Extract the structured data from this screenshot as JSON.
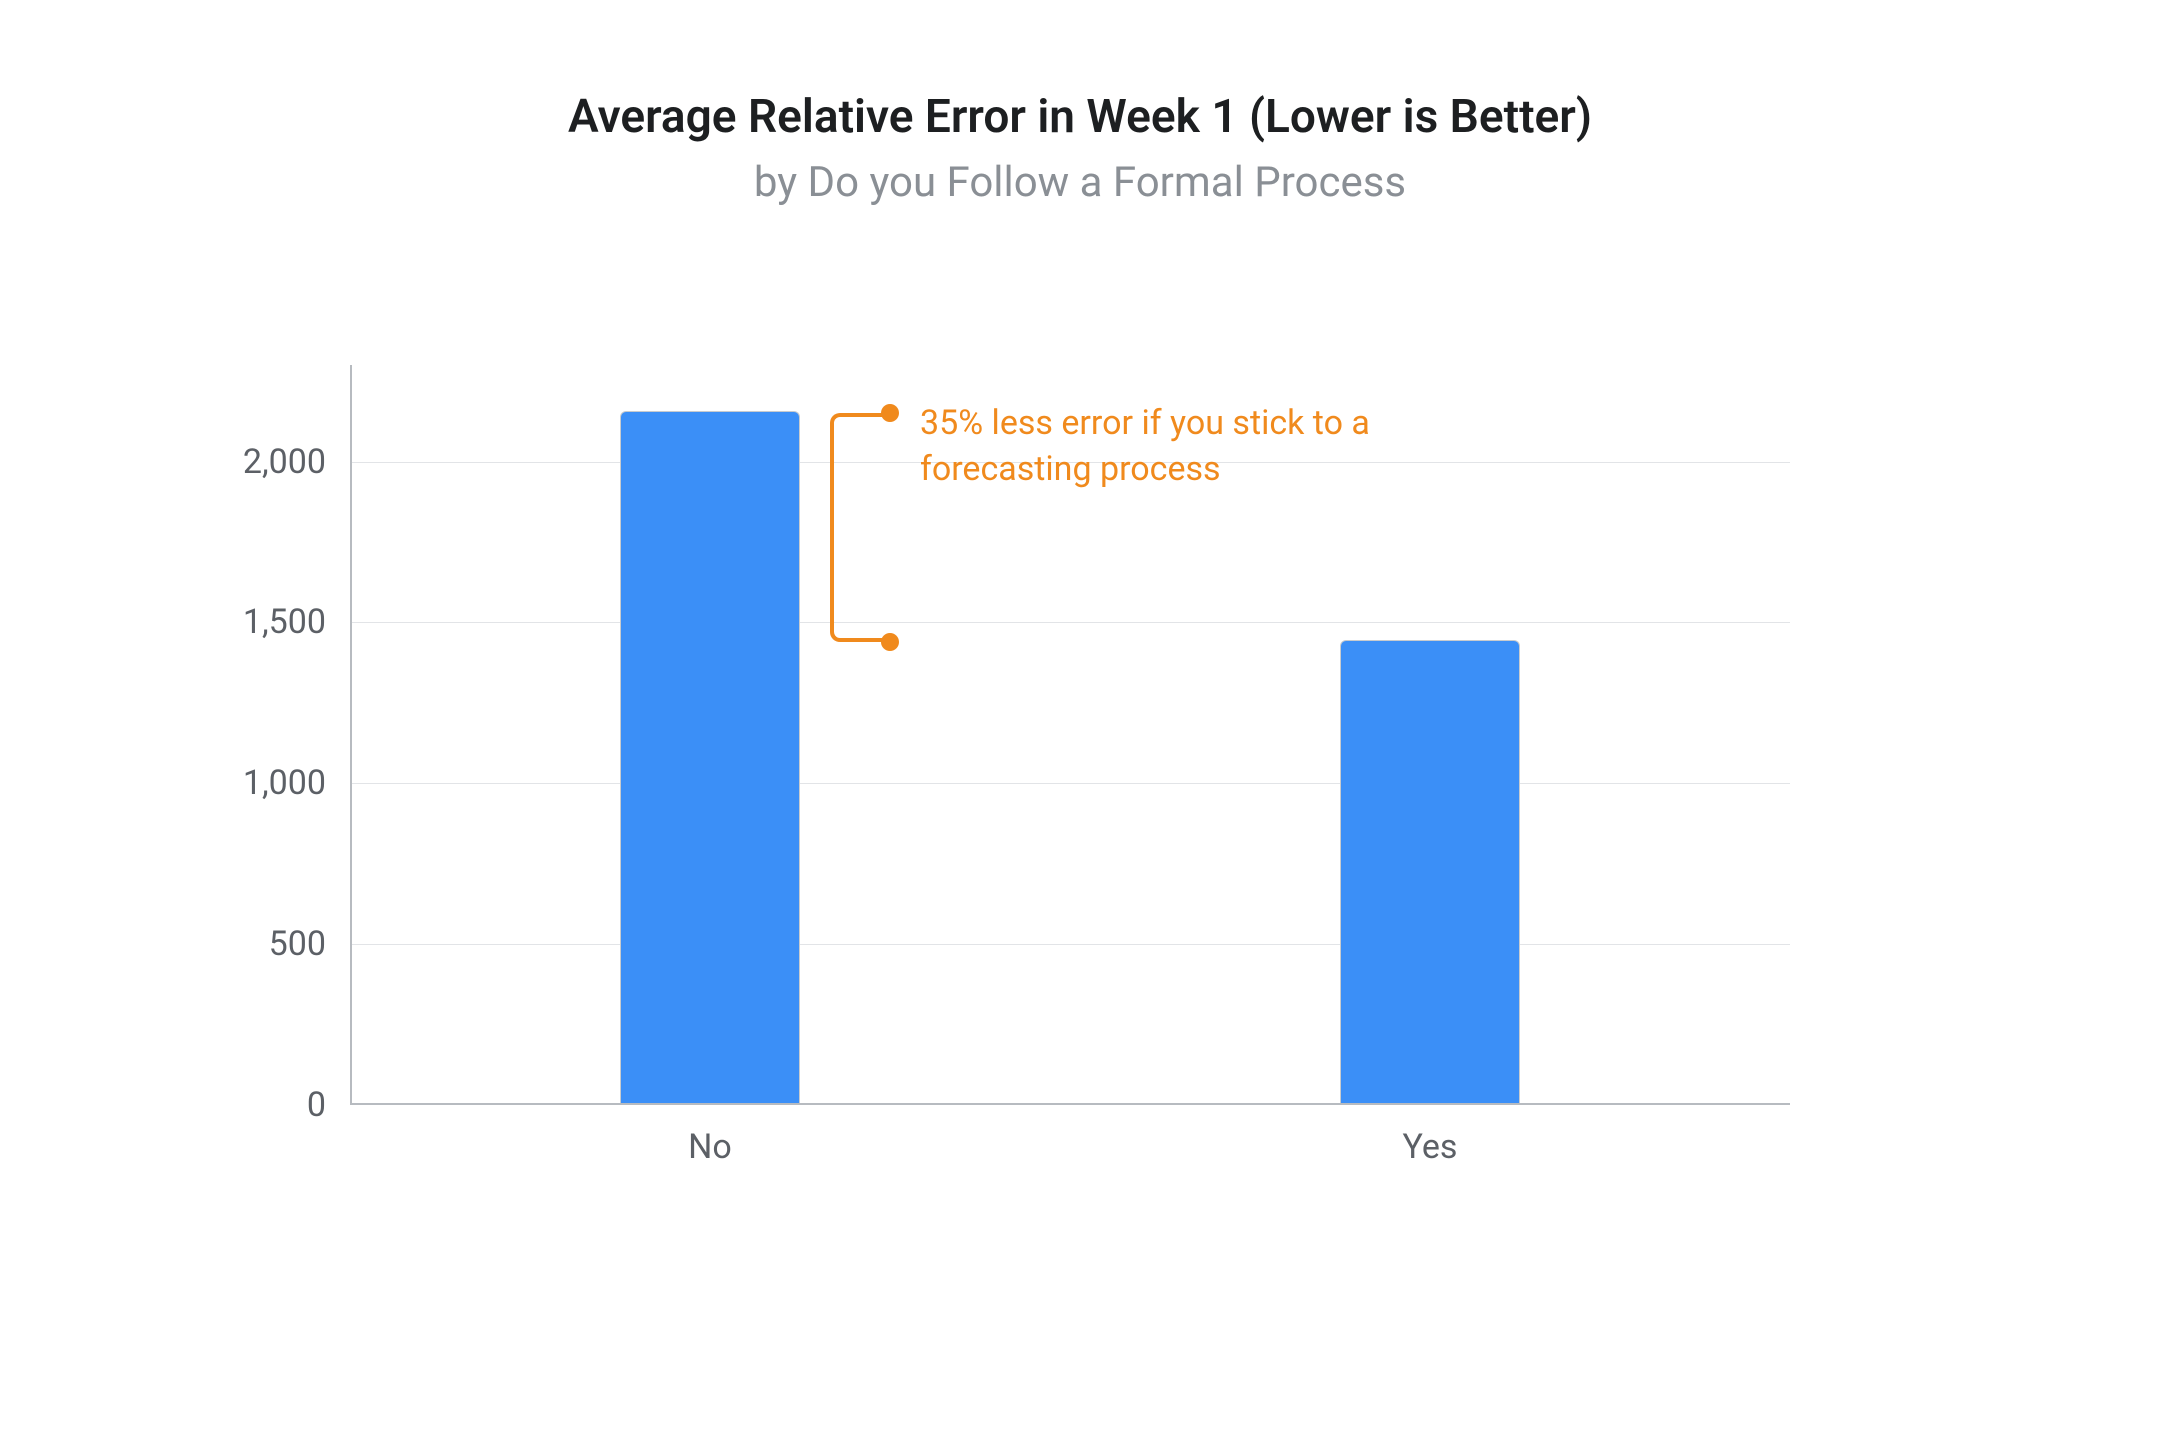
{
  "chart_data": {
    "type": "bar",
    "title": "Average Relative Error in Week 1 (Lower is Better)",
    "subtitle": "by Do you Follow a Formal Process",
    "categories": [
      "No",
      "Yes"
    ],
    "values": [
      2150,
      1440
    ],
    "ylim": [
      0,
      2300
    ],
    "yticks": [
      0,
      500,
      1000,
      1500,
      2000
    ],
    "ytick_labels": [
      "0",
      "500",
      "1,000",
      "1,500",
      "2,000"
    ],
    "xlabel": "",
    "ylabel": "",
    "annotation": {
      "text": "35% less error if you stick to a forecasting process",
      "from_value": 2150,
      "to_value": 1440
    },
    "colors": {
      "bar": "#3b8ff7",
      "annotation": "#f08a1d"
    }
  }
}
